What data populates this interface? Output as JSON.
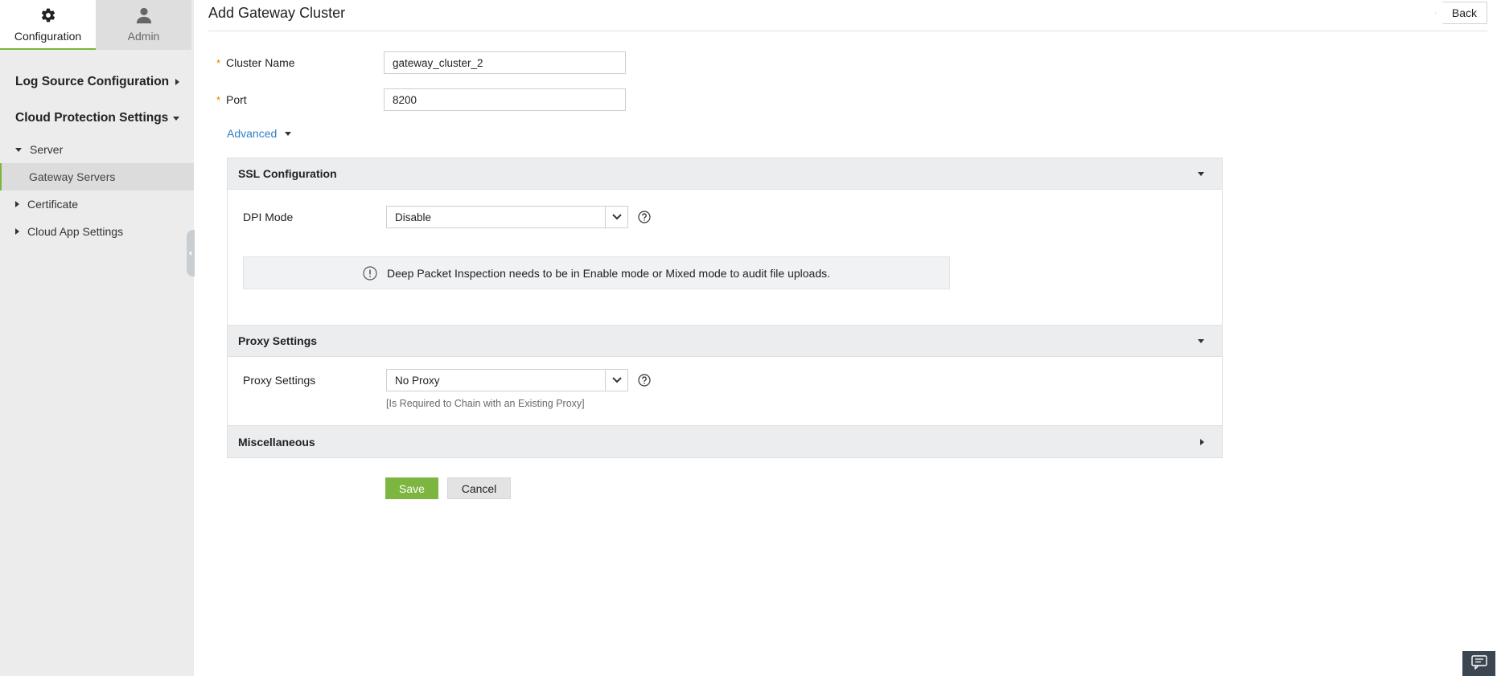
{
  "top_tabs": [
    {
      "label": "Configuration",
      "icon": "gear-icon",
      "active": true
    },
    {
      "label": "Admin",
      "icon": "user-icon",
      "active": false
    }
  ],
  "sidebar": {
    "sections": [
      {
        "label": "Log Source Configuration",
        "expanded": false
      },
      {
        "label": "Cloud Protection Settings",
        "expanded": true
      }
    ],
    "items": [
      {
        "label": "Server",
        "expanded": true
      },
      {
        "label": "Gateway Servers",
        "selected": true
      },
      {
        "label": "Certificate",
        "expanded": false
      },
      {
        "label": "Cloud App Settings",
        "expanded": false
      }
    ]
  },
  "page": {
    "title": "Add Gateway Cluster",
    "back_label": "Back"
  },
  "form": {
    "required_mark": "*",
    "cluster_name_label": "Cluster Name",
    "cluster_name_value": "gateway_cluster_2",
    "port_label": "Port",
    "port_value": "8200",
    "advanced_label": "Advanced"
  },
  "ssl": {
    "header": "SSL Configuration",
    "dpi_label": "DPI Mode",
    "dpi_value": "Disable",
    "info_text": "Deep Packet Inspection needs to be in Enable mode or Mixed mode to audit file uploads."
  },
  "proxy": {
    "header": "Proxy Settings",
    "label": "Proxy Settings",
    "value": "No Proxy",
    "hint": "[Is Required to Chain with an Existing Proxy]"
  },
  "misc": {
    "header": "Miscellaneous"
  },
  "actions": {
    "save_label": "Save",
    "cancel_label": "Cancel"
  },
  "colors": {
    "accent_green": "#7cb53f",
    "link_blue": "#2f7fc1",
    "required_orange": "#e07b00",
    "sidebar_bg": "#ececec"
  }
}
